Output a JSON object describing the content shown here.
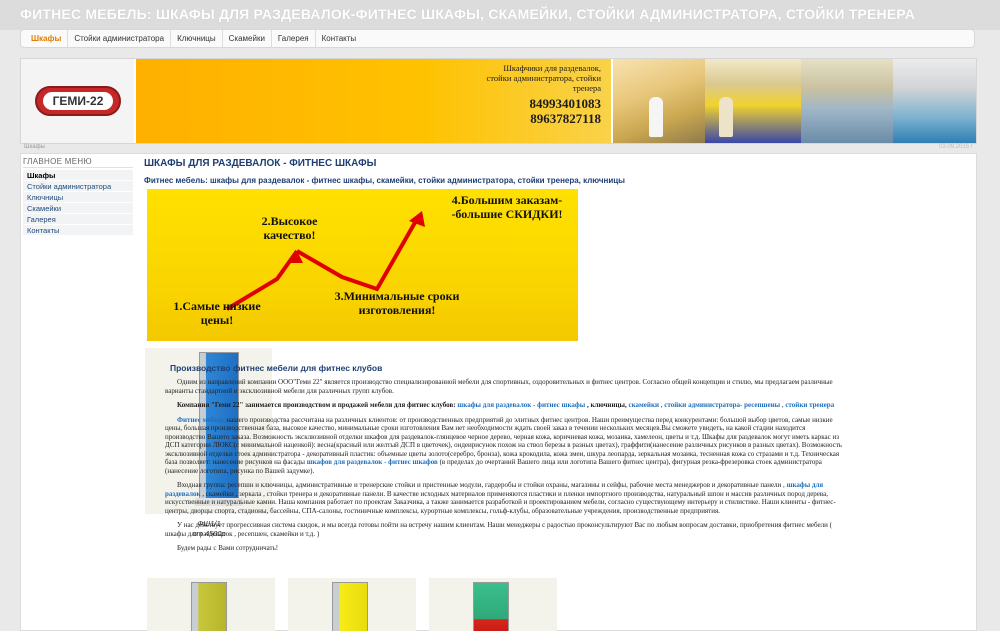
{
  "site_title": "ФИТНЕС МЕБЕЛЬ: ШКАФЫ ДЛЯ РАЗДЕВАЛОК-ФИТНЕС ШКАФЫ, СКАМЕЙКИ, СТОЙКИ АДМИНИСТРАТОРА, СТОЙКИ ТРЕНЕРА",
  "nav": [
    "Шкафы",
    "Стойки администратора",
    "Ключницы",
    "Скамейки",
    "Галерея",
    "Контакты"
  ],
  "logo_text": "ГЕМИ-22",
  "banner": {
    "tagline": "Шкафчики для раздевалок, стойки администратора, стойки тренера",
    "phone1": "84993401083",
    "phone2": "89637827118"
  },
  "breadcrumb": "Шкафы",
  "date": "03.09.2015 г",
  "sidebar": {
    "title": "ГЛАВНОЕ МЕНЮ",
    "items": [
      "Шкафы",
      "Стойки администратора",
      "Ключницы",
      "Скамейки",
      "Галерея",
      "Контакты"
    ]
  },
  "main": {
    "h1": "ШКАФЫ ДЛЯ РАЗДЕВАЛОК - ФИТНЕС ШКАФЫ",
    "h2": "Фитнес мебель:  шкафы для раздевалок - фитнес шкафы, скамейки, стойки администратора, стойки тренера, ключницы"
  },
  "promo": {
    "step1": "1.Самые низкие цены!",
    "step2": "2.Высокое качество!",
    "step3": "3.Минимальные сроки изготовления!",
    "step4": "4.Большим заказам- -большие СКИДКИ!"
  },
  "locker": {
    "code": "ФШ1/1",
    "price": "от 4500р"
  },
  "article": {
    "title": "Производство фитнес мебели для фитнес клубов",
    "p1": "Одним из направлений компании ООО\"Геми 22\" является производство специализированной мебели для спортивных, оздоровительных и фитнес центров. Согласно общей концепции и стилю, мы предлагаем различные варианты стандартной и эксклюзивной мебели для различных групп клубов.",
    "p2a": "Компания \"Геми 22\" занимается производством и продажей мебели для фитнес клубов: ",
    "p2link1": "шкафы для раздевалок - фитнес шкафы",
    "p2b": " , ключницы, ",
    "p2link2": "скамейки",
    "p2c": " , ",
    "p2link3": "стойки администратора- ресепшены",
    "p2d": " , ",
    "p2link4": "стойки тренера",
    "p3link": "Фитнес мебель",
    "p3": " нашего производства рассчитана на различных клиентов: от производственных предприятий до элитных фитнес центров. Наши преимущества перед конкурентами: большой выбор цветов, самые низкие цены, большая производственная база, высокое качество, минимальные сроки изготовления Вам нет необходимости ждать своей заказ в течении нескольких месяцев.Вы сможете увидеть, на какой стадии находится производство Вашего заказа. Возможность эксклюзивной отделки шкафов для раздевалок-глянцевое черное дерево, черная кожа, коричневая кожа, мозаика, хамелеон, цветы и т.д. Шкафы для раздевалок могут иметь каркас из ДСП категории ЛЮКС(с минимальной наценкой): весна(красный или желтый ДСП в цветочек), ондеирисунок похож на ствол березы в разных цветах), граффити(нанесение различных рисунков в разных цветах). Возможность эксклюзивной отделки стоек администратора - декоративный пластик: объемные цветы золото(серебро, бронза), кожа крокодила, кожа змеи, шкура леопарда, зеркальная мозаика, тесненная кожа со стразами и т.д. Техническая база позволяет: нанесение рисунков на фасады ",
    "p3link2": "шкафов для раздевалок - фитнес шкафов",
    "p3end": " (в пределах до очертаний Вашего лица или логотипа Вашего фитнес центра), фигурная резка-фрезеровка стоек администратора (нанесение логотипа, рисунка по Вашей задумке).",
    "p4a": "Входная группа: ресепшн и ключницы, административные и тренерские стойки и пристенные модули, гардеробы и стойки охраны, магазины и сейфы, рабочие места менеджеров и декоративные панели , ",
    "p4link": "шкафы для раздевалок",
    "p4b": " , скамейки , зеркала , стойки тренера и декоративные панели. В качестве исходных материалов применяются пластики и пленки импортного производства, натуральный шпон и массив различных пород дерева, искусственные и натуральные камни. Наша компания работает по проектам Заказчика, а  также занимается разработкой и проектированием мебели, согласно существующему интерьеру и стилистике. Наши клиенты - фитнес-центры, дворцы спорта, стадионы, бассейны, СПА-салоны, гостиничные комплексы, курортные комплексы, гольф-клубы, образовательные учреждения, производственные предприятия.",
    "p5": "У нас действует прогрессивная система скидок, и мы всегда готовы пойти на встречу нашим клиентам. Наши менеджеры с радостью проконсультируют Вас по любым вопросам доставки, приобретения фитнес мебели ( шкафы для раздевалок , ресепшен, скамейки и т.д. )",
    "p6": "Будем рады с Вами сотрудничать!"
  },
  "colors": {
    "accent": "#e37c00",
    "link": "#1f6fbd",
    "heading": "#1f3f73",
    "banner_yellow": "#ffc200"
  }
}
